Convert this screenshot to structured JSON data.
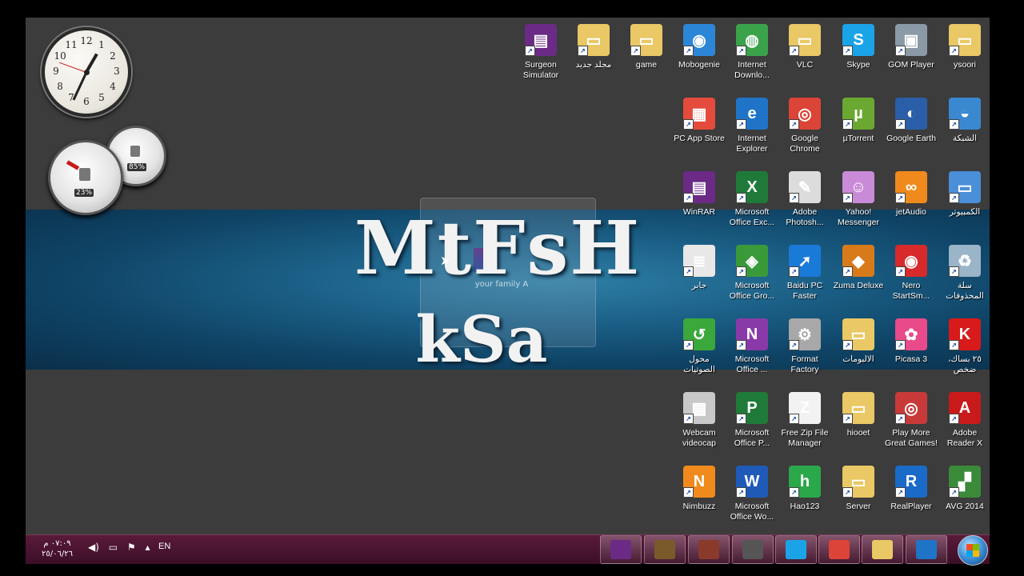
{
  "banner": {
    "title": "MtFsH",
    "subtitle": "kSa"
  },
  "ghost_icon": {
    "label": "your family A"
  },
  "gadgets": {
    "clock_numbers": [
      "12",
      "1",
      "2",
      "3",
      "4",
      "5",
      "6",
      "7",
      "8",
      "9",
      "10",
      "11"
    ],
    "cpu_percent": "23%",
    "memory_percent": "85%"
  },
  "desktop_icons": [
    {
      "name": "surgeon-simulator-icon",
      "label": "Surgeon Simulator",
      "color": "#6b2a86",
      "glyph": "▤"
    },
    {
      "name": "new-folder-icon",
      "label": "مجلد جديد",
      "color": "#e9c865",
      "glyph": "▭"
    },
    {
      "name": "game-folder-icon",
      "label": "game",
      "color": "#e9c865",
      "glyph": "▭"
    },
    {
      "name": "mobogenie-icon",
      "label": "Mobogenie",
      "color": "#2b86d8",
      "glyph": "◉"
    },
    {
      "name": "internet-download-manager-icon",
      "label": "Internet Downlo...",
      "color": "#3aa24a",
      "glyph": "◍"
    },
    {
      "name": "vlc-icon",
      "label": "VLC",
      "color": "#e9c865",
      "glyph": "▭"
    },
    {
      "name": "skype-icon",
      "label": "Skype",
      "color": "#1ba3e8",
      "glyph": "S"
    },
    {
      "name": "gom-player-icon",
      "label": "GOM Player",
      "color": "#8a9aa6",
      "glyph": "▣"
    },
    {
      "name": "ysoori-folder-icon",
      "label": "ysoori",
      "color": "#e9c865",
      "glyph": "▭"
    },
    {
      "name": "pc-app-store-icon",
      "label": "PC App Store",
      "color": "#e44b3c",
      "glyph": "▦"
    },
    {
      "name": "internet-explorer-icon",
      "label": "Internet Explorer",
      "color": "#1f74c8",
      "glyph": "e"
    },
    {
      "name": "google-chrome-icon",
      "label": "Google Chrome",
      "color": "#db4437",
      "glyph": "◎"
    },
    {
      "name": "utorrent-icon",
      "label": "µTorrent",
      "color": "#6aa832",
      "glyph": "µ"
    },
    {
      "name": "google-earth-icon",
      "label": "Google Earth",
      "color": "#2a5ea8",
      "glyph": "◐"
    },
    {
      "name": "network-icon",
      "label": "الشبكة",
      "color": "#3a88d0",
      "glyph": "◒"
    },
    {
      "name": "winrar-icon",
      "label": "WinRAR",
      "color": "#6b2a86",
      "glyph": "▤"
    },
    {
      "name": "microsoft-office-excel-icon",
      "label": "Microsoft Office Exc...",
      "color": "#1f7a3a",
      "glyph": "X"
    },
    {
      "name": "adobe-photoshop-icon",
      "label": "Adobe Photosh...",
      "color": "#dcdcdc",
      "glyph": "✎"
    },
    {
      "name": "yahoo-messenger-icon",
      "label": "Yahoo! Messenger",
      "color": "#c98ad8",
      "glyph": "☺"
    },
    {
      "name": "jetaudio-icon",
      "label": "jetAudio",
      "color": "#f08a1c",
      "glyph": "∞"
    },
    {
      "name": "computer-icon",
      "label": "الكمبيوتر",
      "color": "#4a8fd8",
      "glyph": "▭"
    },
    {
      "name": "jaber-file-icon",
      "label": "جابر",
      "color": "#e8e8e8",
      "glyph": "≣"
    },
    {
      "name": "microsoft-office-groove-icon",
      "label": "Microsoft Office Gro...",
      "color": "#3a9a3a",
      "glyph": "◈"
    },
    {
      "name": "baidu-pc-faster-icon",
      "label": "Baidu PC Faster",
      "color": "#1a7ad8",
      "glyph": "➚"
    },
    {
      "name": "zuma-deluxe-icon",
      "label": "Zuma Deluxe",
      "color": "#d87a1a",
      "glyph": "◆"
    },
    {
      "name": "nero-startsmart-icon",
      "label": "Nero StartSm...",
      "color": "#d82a2a",
      "glyph": "◉"
    },
    {
      "name": "recycle-bin-icon",
      "label": "سلة المحذوفات",
      "color": "#9ab4c8",
      "glyph": "♻"
    },
    {
      "name": "audio-converter-icon",
      "label": "محول الصوتيات",
      "color": "#3aa83a",
      "glyph": "↺"
    },
    {
      "name": "microsoft-office-onenote-icon",
      "label": "Microsoft Office ...",
      "color": "#8a3aa8",
      "glyph": "N"
    },
    {
      "name": "format-factory-icon",
      "label": "Format Factory",
      "color": "#a8a8a8",
      "glyph": "⚙"
    },
    {
      "name": "albums-folder-icon",
      "label": "الالبومات",
      "color": "#e9c865",
      "glyph": "▭"
    },
    {
      "name": "picasa-3-icon",
      "label": "Picasa 3",
      "color": "#e84a8a",
      "glyph": "✿"
    },
    {
      "name": "kaspersky-icon",
      "label": "٢٥ بساك، ضخص",
      "color": "#d81a1a",
      "glyph": "K"
    },
    {
      "name": "webcam-videocap-icon",
      "label": "Webcam videocap",
      "color": "#c8c8c8",
      "glyph": "▩"
    },
    {
      "name": "microsoft-office-powerpoint-icon",
      "label": "Microsoft Office P...",
      "color": "#1f7a3a",
      "glyph": "P"
    },
    {
      "name": "free-zip-file-manager-icon",
      "label": "Free Zip File Manager",
      "color": "#f2f2f2",
      "glyph": "Z"
    },
    {
      "name": "hiooet-folder-icon",
      "label": "hiooet",
      "color": "#e9c865",
      "glyph": "▭"
    },
    {
      "name": "play-more-great-games-icon",
      "label": "Play More Great Games!",
      "color": "#c83a3a",
      "glyph": "◎"
    },
    {
      "name": "adobe-reader-x-icon",
      "label": "Adobe Reader X",
      "color": "#c81a1a",
      "glyph": "A"
    },
    {
      "name": "nimbuzz-icon",
      "label": "Nimbuzz",
      "color": "#f08a1c",
      "glyph": "N"
    },
    {
      "name": "microsoft-office-word-icon",
      "label": "Microsoft Office Wo...",
      "color": "#1f5ab8",
      "glyph": "W"
    },
    {
      "name": "hao123-icon",
      "label": "Hao123",
      "color": "#2aa84a",
      "glyph": "h"
    },
    {
      "name": "server-folder-icon",
      "label": "Server",
      "color": "#e9c865",
      "glyph": "▭"
    },
    {
      "name": "realplayer-icon",
      "label": "RealPlayer",
      "color": "#1a6ac8",
      "glyph": "R"
    },
    {
      "name": "avg-2014-icon",
      "label": "AVG 2014",
      "color": "#3a8a3a",
      "glyph": "▞"
    }
  ],
  "taskbar": {
    "clock_time": "٠٧:٠٩ م",
    "clock_date": "٢٥/٠٦/٢٦",
    "language": "EN",
    "tray_icons": [
      "volume-icon",
      "network-tray-icon",
      "flag-icon",
      "show-hidden-icon"
    ],
    "pinned": [
      {
        "name": "taskbar-winrar",
        "color": "#6b2a86"
      },
      {
        "name": "taskbar-minecraft",
        "color": "#7a5a2a"
      },
      {
        "name": "taskbar-app3",
        "color": "#8a3a2a"
      },
      {
        "name": "taskbar-app4",
        "color": "#555555"
      },
      {
        "name": "taskbar-skype",
        "color": "#1ba3e8"
      },
      {
        "name": "taskbar-chrome",
        "color": "#db4437"
      },
      {
        "name": "taskbar-explorer",
        "color": "#e9c865"
      },
      {
        "name": "taskbar-ie",
        "color": "#1f74c8"
      }
    ]
  }
}
